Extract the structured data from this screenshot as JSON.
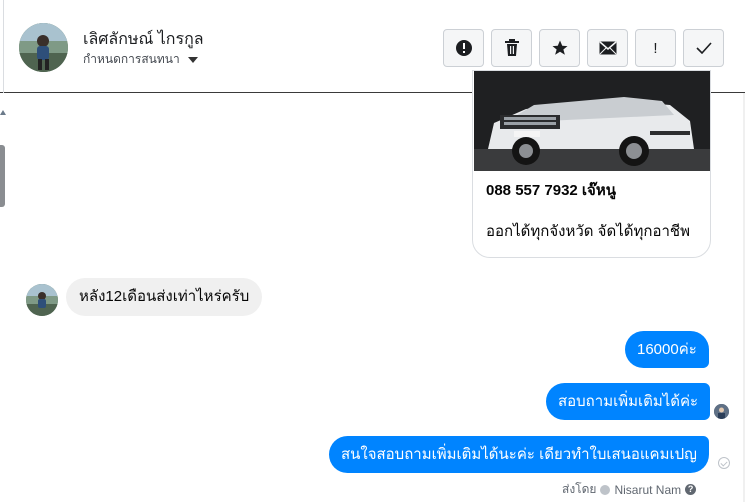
{
  "conversation": {
    "contact_name": "เลิศลักษณ์ ไกรกูล",
    "subtitle": "กำหนดการสนทนา"
  },
  "toolbar": [
    {
      "icon": "alert-circle-icon",
      "label": ""
    },
    {
      "icon": "trash-icon",
      "label": ""
    },
    {
      "icon": "star-icon",
      "label": ""
    },
    {
      "icon": "envelope-icon",
      "label": ""
    },
    {
      "icon": "exclamation-icon",
      "label": "!"
    },
    {
      "icon": "check-icon",
      "label": ""
    }
  ],
  "card": {
    "title": "088 557 7932 เจ๊หนู",
    "description": "ออกได้ทุกจังหวัด จัดได้ทุกอาชีพ"
  },
  "messages": {
    "incoming": "หลัง12เดือนส่งเท่าไหร่ครับ",
    "outgoing": [
      "16000ค่ะ",
      "สอบถามเพิ่มเติมได้ค่ะ",
      "สนใจสอบถามเพิ่มเติมได้นะค่ะ เดียวทำใบเสนอแคมเปญ"
    ]
  },
  "footer": {
    "sent_by_label": "ส่งโดย",
    "sender_name": "Nisarut Nam"
  },
  "colors": {
    "outgoing_bubble": "#0084ff",
    "incoming_bubble": "#f0f0f0",
    "toolbar_button": "#f5f6f7"
  }
}
